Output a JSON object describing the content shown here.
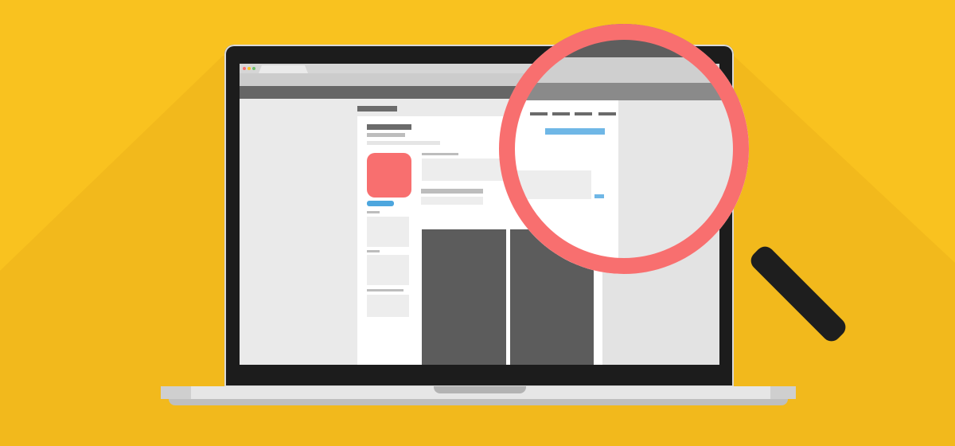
{
  "colors": {
    "background": "#F9C21F",
    "accent_red": "#F86F6F",
    "accent_blue": "#4DA6DE",
    "laptop_bezel": "#1C1C1C",
    "handle": "#1E1E1E"
  },
  "icons": {
    "laptop": "laptop-icon",
    "magnifier": "magnifying-glass-icon",
    "app_icon": "app-icon-placeholder"
  }
}
